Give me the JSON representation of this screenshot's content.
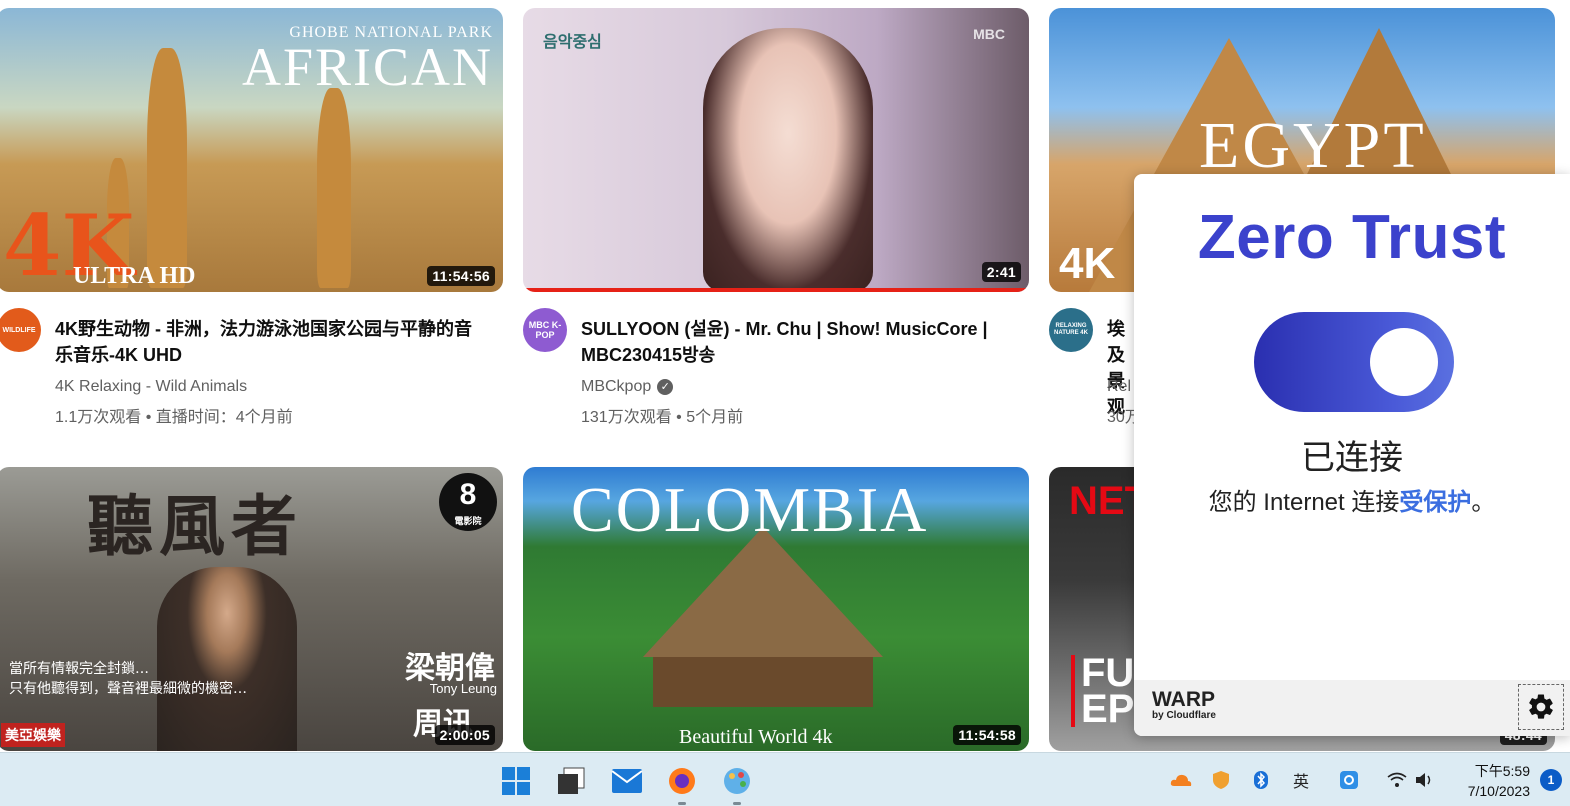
{
  "videos": [
    {
      "title": "4K野生动物 - 非洲，法力游泳池国家公园与平静的音乐音乐-4K UHD",
      "channel": "4K Relaxing - Wild Animals",
      "views": "1.1万次观看 • 直播时间：4个月前",
      "duration": "11:54:56",
      "thumb_text_1": "GHOBE NATIONAL PARK",
      "thumb_text_2": "AFRICAN",
      "thumb_text_3": "4K",
      "thumb_text_4": "ULTRA HD",
      "avatar_text": "WILDLIFE"
    },
    {
      "title": "SULLYOON (설윤) - Mr. Chu | Show! MusicCore | MBC230415방송",
      "channel": "MBCkpop",
      "verified": "✓",
      "views": "131万次观看 • 5个月前",
      "duration": "2:41",
      "thumb_text_1": "음악중심",
      "thumb_text_2": "MBC",
      "avatar_text": "MBC K-POP"
    },
    {
      "title": "埃及景观",
      "channel": "Rel",
      "views": "30万",
      "thumb_text_1": "EGYPT",
      "thumb_text_2": "4K",
      "avatar_text": "RELAXING NATURE 4K"
    },
    {
      "duration": "2:00:05",
      "thumb_text_1": "聽風者",
      "thumb_text_2": "8",
      "thumb_text_3": "電影院",
      "thumb_text_4": "梁朝偉",
      "thumb_text_5": "Tony Leung",
      "thumb_text_6": "周讯",
      "thumb_text_7": "當所有情報完全封鎖…\n只有他聽得到，聲音裡最細微的機密…",
      "thumb_text_8": "美亞娛樂"
    },
    {
      "duration": "11:54:58",
      "thumb_text_1": "COLOMBIA",
      "thumb_text_2": "Beautiful World 4k"
    },
    {
      "duration": "48:44",
      "thumb_text_1": "NET",
      "thumb_text_2": "FU EP"
    }
  ],
  "warp": {
    "heading": "Zero Trust",
    "status": "已连接",
    "message_prefix": "您的 Internet 连接",
    "message_highlight": "受保护",
    "message_suffix": "。",
    "brand": "WARP",
    "brand_sub": "by Cloudflare",
    "toggle_on": true
  },
  "taskbar": {
    "time": "下午5:59",
    "date": "7/10/2023",
    "ime": "英",
    "notification_count": "1"
  },
  "colors": {
    "warp_accent": "#3b42cc",
    "warp_link": "#3b6ee0",
    "progress_red": "#e62117"
  }
}
